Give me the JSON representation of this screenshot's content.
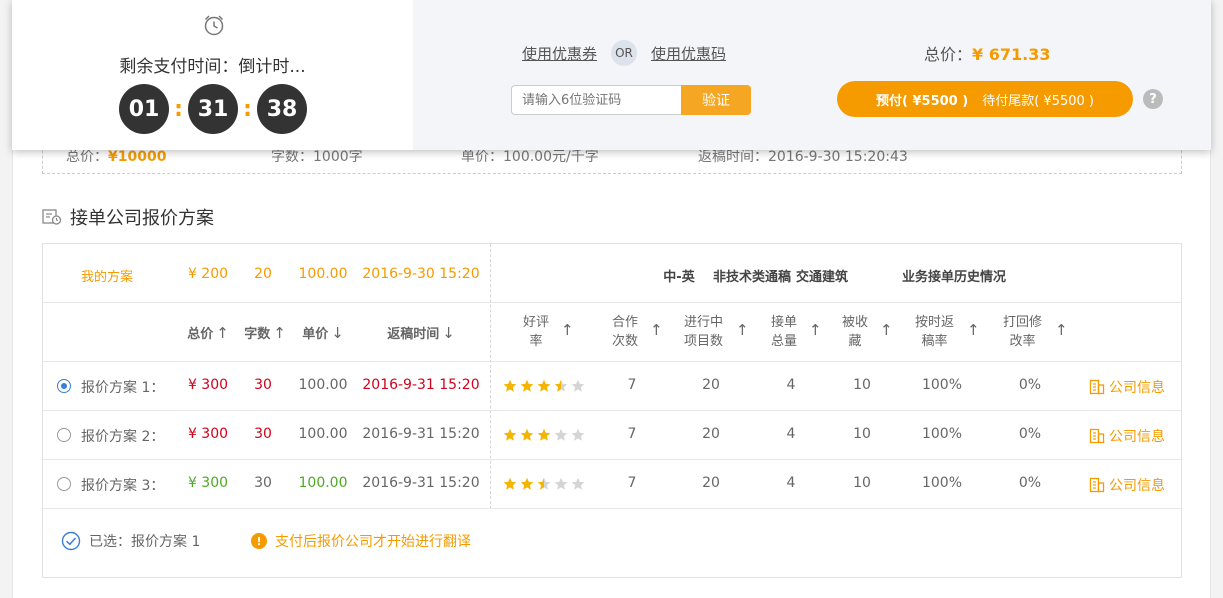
{
  "countdown": {
    "label": "剩余支付时间：倒计时...",
    "hours": "01",
    "minutes": "31",
    "seconds": "38",
    "sep": ":"
  },
  "coupon": {
    "link_coupon": "使用优惠券",
    "or": "OR",
    "link_code": "使用优惠码",
    "input_placeholder": "请输入6位验证码",
    "verify_label": "验证"
  },
  "payment": {
    "total_label": "总价：",
    "total_amount": "¥ 671.33",
    "prepay_label": "预付( ¥5500 )",
    "balance_label": "待付尾款( ¥5500 )",
    "help": "?"
  },
  "order_info": {
    "total": "总价：¥10000",
    "total_prefix": "总价：",
    "total_value": "¥10000",
    "words": "字数：1000字",
    "unit_price": "单价：100.00元/千字",
    "return_time": "返稿时间：2016-9-30 15:20:43"
  },
  "section_title": "接单公司报价方案",
  "my_plan": {
    "label": "我的方案",
    "total": "¥ 200",
    "words": "20",
    "unit_price": "100.00",
    "time": "2016-9-30 15:20",
    "tags": [
      "中-英",
      "非技术类通稿",
      "交通建筑"
    ],
    "history": "业务接单历史情况"
  },
  "headers": {
    "total": "总价",
    "words": "字数",
    "unit_price": "单价",
    "return_time": "返稿时间",
    "rating_1": "好评",
    "rating_2": "率",
    "coop_1": "合作",
    "coop_2": "次数",
    "ongoing_1": "进行中",
    "ongoing_2": "项目数",
    "orders_1": "接单",
    "orders_2": "总量",
    "fav_1": "被收",
    "fav_2": "藏",
    "ontime_1": "按时返",
    "ontime_2": "稿率",
    "rework_1": "打回修",
    "rework_2": "改率",
    "arrow_up": "↑",
    "arrow_down": "↓"
  },
  "plans": [
    {
      "label": "报价方案 1：",
      "total": "¥ 300",
      "words": "30",
      "unit_price": "100.00",
      "time": "2016-9-31 15:20",
      "stars": 3.5,
      "coop": "7",
      "ongoing": "20",
      "orders": "4",
      "fav": "10",
      "ontime": "100%",
      "rework": "0%",
      "company": "公司信息",
      "selected": true
    },
    {
      "label": "报价方案 2：",
      "total": "¥ 300",
      "words": "30",
      "unit_price": "100.00",
      "time": "2016-9-31 15:20",
      "stars": 3,
      "coop": "7",
      "ongoing": "20",
      "orders": "4",
      "fav": "10",
      "ontime": "100%",
      "rework": "0%",
      "company": "公司信息",
      "selected": false
    },
    {
      "label": "报价方案 3：",
      "total": "¥ 300",
      "words": "30",
      "unit_price": "100.00",
      "time": "2016-9-31 15:20",
      "stars": 2.5,
      "coop": "7",
      "ongoing": "20",
      "orders": "4",
      "fav": "10",
      "ontime": "100%",
      "rework": "0%",
      "company": "公司信息",
      "selected": false
    }
  ],
  "footer": {
    "selected": "已选：报价方案 1",
    "tip": "支付后报价公司才开始进行翻译"
  },
  "colors": {
    "accent": "#f59b00",
    "red": "#d0021b",
    "green": "#4caa22",
    "blue": "#3a7fd5",
    "star_on": "#f5b400",
    "star_off": "#d5d5d5"
  }
}
